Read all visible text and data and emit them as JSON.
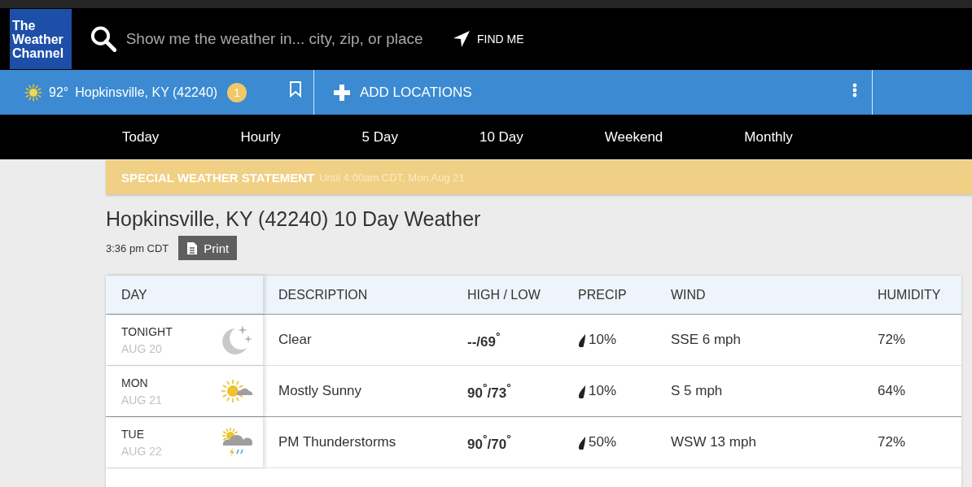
{
  "header": {
    "logo": [
      "The",
      "Weather",
      "Channel"
    ],
    "search": {
      "placeholder": "Show me the weather in... city, zip, or place"
    },
    "find_me": "FIND ME"
  },
  "location_bar": {
    "temperature": "92°",
    "location": "Hopkinsville, KY (42240)",
    "alert_count": "1",
    "add_locations": "ADD LOCATIONS"
  },
  "tabs": [
    {
      "label": "Today"
    },
    {
      "label": "Hourly"
    },
    {
      "label": "5 Day"
    },
    {
      "label": "10 Day"
    },
    {
      "label": "Weekend"
    },
    {
      "label": "Monthly"
    }
  ],
  "alert": {
    "title": "SPECIAL WEATHER STATEMENT",
    "detail": "Until 4:00am CDT, Mon Aug 21"
  },
  "page_title": "Hopkinsville, KY (42240) 10 Day Weather",
  "updated": "3:36 pm CDT",
  "print": "Print",
  "table": {
    "columns": [
      "DAY",
      "DESCRIPTION",
      "HIGH / LOW",
      "PRECIP",
      "WIND",
      "HUMIDITY"
    ],
    "rows": [
      {
        "day": "TONIGHT",
        "date": "AUG 20",
        "kind": "night",
        "description": "Clear",
        "high_low": "--/69$^{°}$",
        "precip": "10%",
        "wind": "SSE 6 mph",
        "humidity": "72%"
      },
      {
        "day": "MON",
        "date": "AUG 21",
        "kind": "sun-cloud",
        "description": "Mostly Sunny",
        "high_low": "90$^{°}$/73$^{°}$",
        "precip": "10%",
        "wind": "S 5 mph",
        "humidity": "64%"
      },
      {
        "day": "TUE",
        "date": "AUG 22",
        "kind": "storm",
        "description": "PM Thunderstorms",
        "high_low": "90$^{°}$/70$^{°}$",
        "precip": "50%",
        "wind": "WSW 13 mph",
        "humidity": "72%"
      }
    ]
  }
}
